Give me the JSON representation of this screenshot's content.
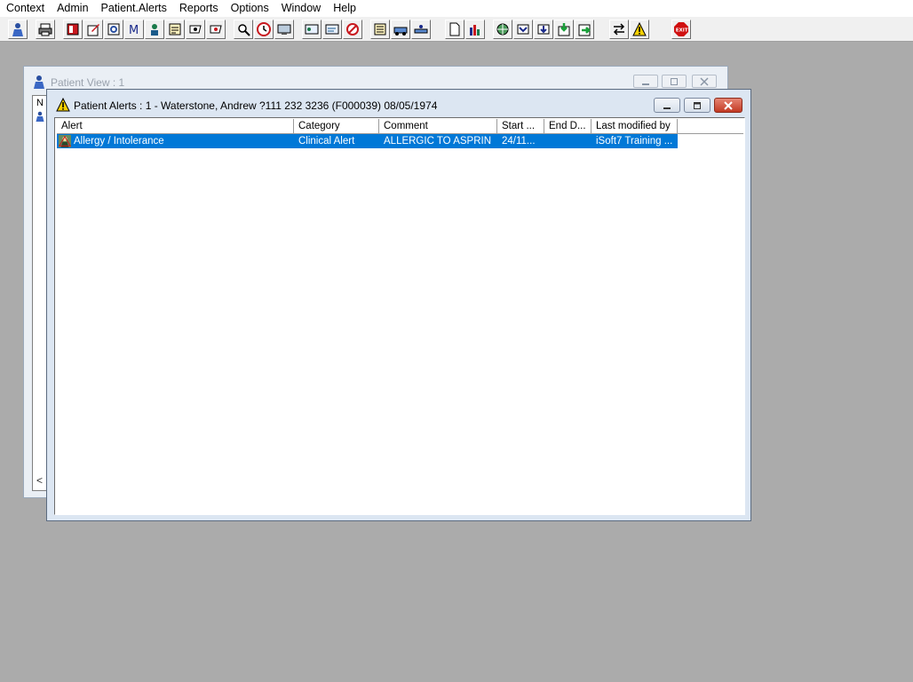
{
  "menu": [
    "Context",
    "Admin",
    "Patient.Alerts",
    "Reports",
    "Options",
    "Window",
    "Help"
  ],
  "toolbar_icons": [
    "user-icon",
    "printer-icon",
    "book-icon",
    "edit-icon",
    "search-doc-icon",
    "mail-icon",
    "doctor-icon",
    "form-icon",
    "flag-icon",
    "flag-alt-icon",
    "find-icon",
    "clock-icon",
    "screen-icon",
    "card-icon",
    "note-icon",
    "forbidden-icon",
    "notes-icon",
    "transfer-icon",
    "bed-icon",
    "document-icon",
    "chart-icon",
    "globe-icon",
    "tray-in-icon",
    "tray-down-icon",
    "arrow-green-icon",
    "arrow-right-icon",
    "swap-icon",
    "warning-icon",
    "exit-icon"
  ],
  "back_window": {
    "title": "Patient View : 1",
    "header_n": "N",
    "scroll_glyph": "<"
  },
  "alerts_window": {
    "title": "Patient Alerts : 1 - Waterstone, Andrew ?111 232 3236 (F000039) 08/05/1974",
    "columns": [
      "Alert",
      "Category",
      "Comment",
      "Start ...",
      "End D...",
      "Last modified by"
    ],
    "rows": [
      {
        "alert": "Allergy / Intolerance",
        "category": "Clinical Alert",
        "comment": "ALLERGIC TO ASPRIN",
        "start": "24/11...",
        "end": "",
        "modified_by": "iSoft7 Training ..."
      }
    ]
  },
  "colors": {
    "selection": "#0078d7",
    "desktop": "#ababab",
    "exit_button": "#d01010"
  }
}
